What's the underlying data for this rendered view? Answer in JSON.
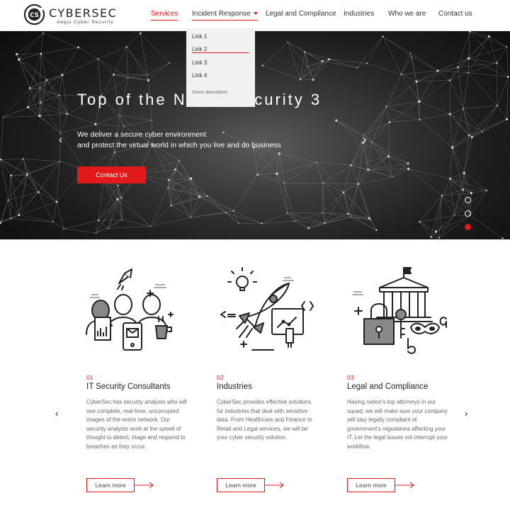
{
  "logo": {
    "name": "CYBERSEC",
    "tagline": "Aegis Cyber Security",
    "icon": "cs-logo-icon"
  },
  "nav": {
    "services": "Services",
    "incident": "Incident Response",
    "legal": "Legal and Compilance",
    "industries": "Industries",
    "who": "Who we are",
    "contact": "Contact us"
  },
  "dropdown": {
    "links": [
      "Link 1",
      "Link 2",
      "Link 3",
      "Link 4"
    ],
    "description": "Some description",
    "active_index": 1
  },
  "hero": {
    "title": "Top of the Notch Security 3",
    "subtitle_line1": "We deliver a secure cyber environment",
    "subtitle_line2": "and protect the virtual world in which you live and do business",
    "cta": "Contact Us",
    "prev_icon": "chevron-left-icon",
    "next_icon": "chevron-right-icon",
    "slides": 3,
    "active_slide": 3
  },
  "services": [
    {
      "number": "01",
      "title": "IT Security Consultants",
      "description": "CyberSec has security analysts who will see complete, real-time, uncorrupted images of the entire network. Our security analysts work at the speed of thought to detect, triage and respond to breaches as they occur.",
      "cta": "Learn more",
      "icon": "team-consultants-icon"
    },
    {
      "number": "02",
      "title": "Industries",
      "description": "CyberSec provides effective solutions for industries that deal with sensitive data. From Healthcare and Finance to Retail and Legal services, we will be your cyber security solution.",
      "cta": "Learn more",
      "icon": "rocket-industries-icon"
    },
    {
      "number": "03",
      "title": "Legal and Compliance",
      "description": "Having nation's top attorneys in our squad, we will make sure your company will stay legally compliant of government's regulations affecting your IT. Let the legal issues not interrupt your workflow.",
      "cta": "Learn more",
      "icon": "lock-legal-icon"
    }
  ],
  "colors": {
    "accent": "#e1191b",
    "dark": "#111111",
    "dropdown_bg": "#f1f1f1"
  }
}
